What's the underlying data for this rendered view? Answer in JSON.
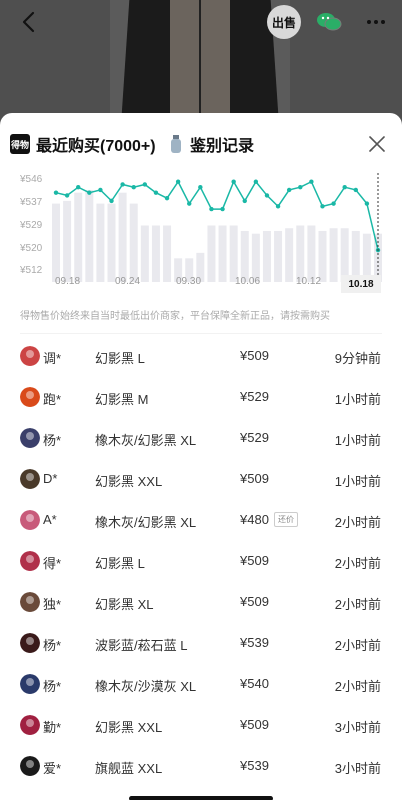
{
  "header": {
    "sell_label": "出售",
    "more_icon": "more-icon"
  },
  "sheet": {
    "tab_recent_logo": "得物",
    "tab_recent_label": "最近购买(7000+)",
    "tab_auth_label": "鉴别记录",
    "close_icon": "close-icon"
  },
  "chart_data": {
    "type": "line",
    "ylim": [
      512,
      546
    ],
    "yticks": [
      "¥546",
      "¥537",
      "¥529",
      "¥520",
      "¥512"
    ],
    "xticks": [
      "09.18",
      "09.24",
      "09.30",
      "10.06",
      "10.12",
      "10.18"
    ],
    "active_x": "10.18",
    "values": [
      541,
      540,
      543,
      541,
      542,
      538,
      544,
      543,
      544,
      541,
      539,
      545,
      537,
      543,
      535,
      535,
      545,
      538,
      545,
      540,
      536,
      542,
      543,
      545,
      536,
      537,
      543,
      542,
      537,
      520
    ],
    "bars": [
      537,
      538,
      541,
      542,
      537,
      537,
      541,
      537,
      529,
      529,
      529,
      517,
      517,
      519,
      529,
      529,
      529,
      527,
      526,
      527,
      527,
      528,
      529,
      529,
      527,
      528,
      528,
      527,
      526,
      526
    ],
    "line_color": "#1ab8a6",
    "bar_color": "#e9e9ee"
  },
  "notice": "得物售价始终来自当时最低出价商家，平台保障全新正品，请按需购买",
  "rows": [
    {
      "name": "调*",
      "spec": "幻影黑 L",
      "price": "¥509",
      "tag": "",
      "time": "9分钟前"
    },
    {
      "name": "跑*",
      "spec": "幻影黑 M",
      "price": "¥529",
      "tag": "",
      "time": "1小时前"
    },
    {
      "name": "杨*",
      "spec": "橡木灰/幻影黑 XL",
      "price": "¥529",
      "tag": "",
      "time": "1小时前"
    },
    {
      "name": "D*",
      "spec": "幻影黑 XXL",
      "price": "¥509",
      "tag": "",
      "time": "1小时前"
    },
    {
      "name": "A*",
      "spec": "橡木灰/幻影黑 XL",
      "price": "¥480",
      "tag": "还价",
      "time": "2小时前"
    },
    {
      "name": "得*",
      "spec": "幻影黑 L",
      "price": "¥509",
      "tag": "",
      "time": "2小时前"
    },
    {
      "name": "独*",
      "spec": "幻影黑 XL",
      "price": "¥509",
      "tag": "",
      "time": "2小时前"
    },
    {
      "name": "杨*",
      "spec": "波影蓝/菘石蓝 L",
      "price": "¥539",
      "tag": "",
      "time": "2小时前"
    },
    {
      "name": "杨*",
      "spec": "橡木灰/沙漠灰 XL",
      "price": "¥540",
      "tag": "",
      "time": "2小时前"
    },
    {
      "name": "勤*",
      "spec": "幻影黑 XXL",
      "price": "¥509",
      "tag": "",
      "time": "3小时前"
    },
    {
      "name": "爱*",
      "spec": "旗舰蓝 XXL",
      "price": "¥539",
      "tag": "",
      "time": "3小时前"
    }
  ]
}
